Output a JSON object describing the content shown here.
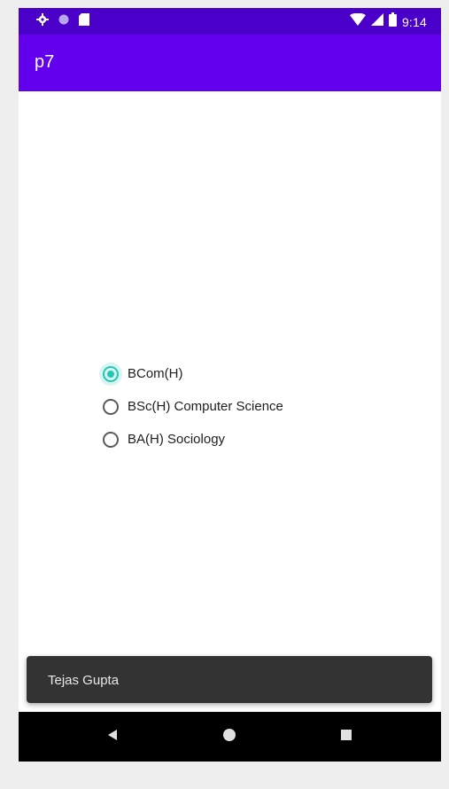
{
  "status_bar": {
    "time": "9:14",
    "left_icons": [
      "gear-icon",
      "circle-icon",
      "sd-card-icon"
    ],
    "right_icons": [
      "wifi-icon",
      "signal-icon",
      "battery-icon"
    ]
  },
  "app_bar": {
    "title": "p7",
    "color": "#6200ee"
  },
  "radio_group": {
    "options": [
      {
        "label": "BCom(H)",
        "checked": true
      },
      {
        "label": "BSc(H) Computer Science",
        "checked": false
      },
      {
        "label": "BA(H) Sociology",
        "checked": false
      }
    ],
    "accent_color": "#26c6b5"
  },
  "snackbar": {
    "text": "Tejas Gupta"
  },
  "nav_bar": {
    "buttons": [
      "back-icon",
      "home-icon",
      "recents-icon"
    ]
  }
}
